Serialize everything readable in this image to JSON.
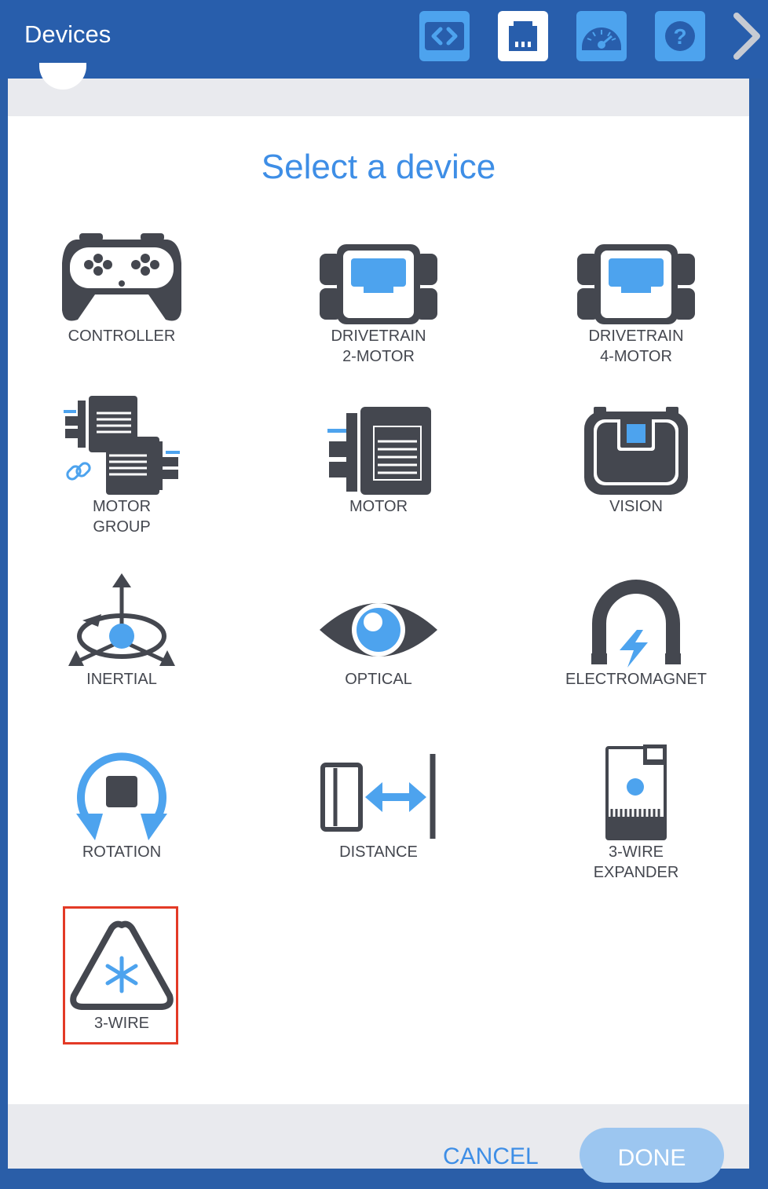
{
  "header": {
    "title": "Devices",
    "buttons": [
      {
        "name": "code-view",
        "icon": "code-icon"
      },
      {
        "name": "devices",
        "icon": "port-icon",
        "active": true
      },
      {
        "name": "dashboard",
        "icon": "gauge-icon"
      },
      {
        "name": "help",
        "icon": "question-icon"
      }
    ]
  },
  "dialog": {
    "title": "Select a device",
    "cancel_label": "CANCEL",
    "done_label": "DONE"
  },
  "devices": [
    {
      "line1": "CONTROLLER",
      "line2": "",
      "icon": "controller-icon"
    },
    {
      "line1": "DRIVETRAIN",
      "line2": "2-MOTOR",
      "icon": "drivetrain-2-motor-icon"
    },
    {
      "line1": "DRIVETRAIN",
      "line2": "4-MOTOR",
      "icon": "drivetrain-4-motor-icon"
    },
    {
      "line1": "MOTOR",
      "line2": "GROUP",
      "icon": "motor-group-icon"
    },
    {
      "line1": "MOTOR",
      "line2": "",
      "icon": "motor-icon"
    },
    {
      "line1": "VISION",
      "line2": "",
      "icon": "vision-sensor-icon"
    },
    {
      "line1": "INERTIAL",
      "line2": "",
      "icon": "inertial-sensor-icon"
    },
    {
      "line1": "OPTICAL",
      "line2": "",
      "icon": "optical-eye-icon"
    },
    {
      "line1": "ELECTROMAGNET",
      "line2": "",
      "icon": "electromagnet-icon"
    },
    {
      "line1": "ROTATION",
      "line2": "",
      "icon": "rotation-sensor-icon"
    },
    {
      "line1": "DISTANCE",
      "line2": "",
      "icon": "distance-sensor-icon"
    },
    {
      "line1": "3-WIRE",
      "line2": "EXPANDER",
      "icon": "three-wire-expander-icon"
    },
    {
      "line1": "3-WIRE",
      "line2": "",
      "icon": "three-wire-icon",
      "selected": true
    }
  ],
  "colors": {
    "header": "#285eac",
    "accent": "#3e8ee6",
    "icon_dark": "#44474f",
    "icon_blue": "#4aa6df",
    "selection": "#e33a26"
  }
}
